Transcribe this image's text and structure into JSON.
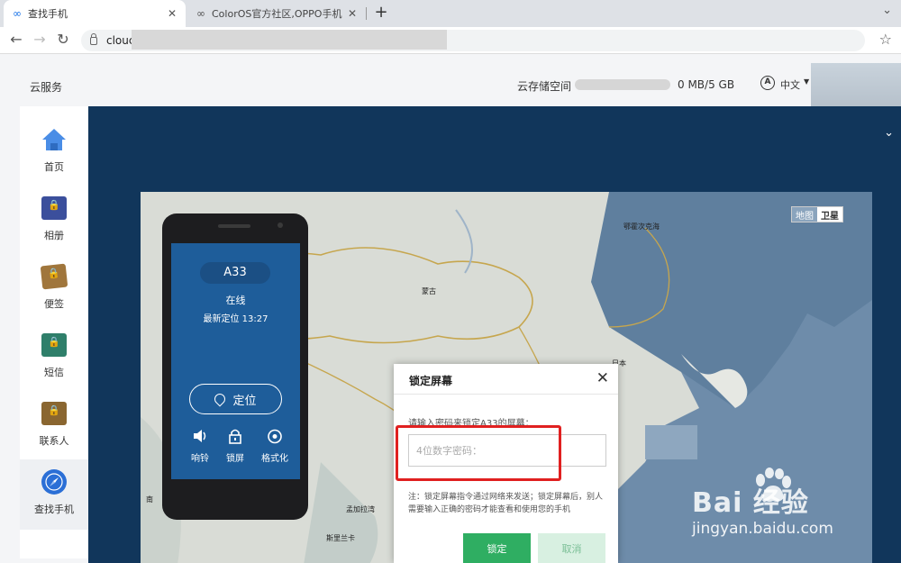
{
  "browser": {
    "tabs": [
      {
        "title": "查找手机",
        "active": true
      },
      {
        "title": "ColorOS官方社区,OPPO手机系",
        "active": false
      }
    ],
    "new_tab": "+",
    "url": "clouc"
  },
  "header": {
    "brand": "云服务",
    "storage_label": "云存储空间",
    "storage_used_fraction": 0.0,
    "storage_text": "0 MB/5 GB",
    "language": "中文"
  },
  "sidebar": {
    "items": [
      {
        "label": "首页",
        "icon": "home-icon",
        "color": "#4a8de6"
      },
      {
        "label": "相册",
        "icon": "album-lock-icon",
        "color": "#3b4f9c"
      },
      {
        "label": "便签",
        "icon": "notes-lock-icon",
        "color": "#a0763c"
      },
      {
        "label": "短信",
        "icon": "sms-lock-icon",
        "color": "#2f7f6a"
      },
      {
        "label": "联系人",
        "icon": "contacts-lock-icon",
        "color": "#8a6630"
      },
      {
        "label": "查找手机",
        "icon": "find-phone-icon",
        "color": "#2b6fd6",
        "active": true
      }
    ]
  },
  "map": {
    "toggle": {
      "map": "地图",
      "satellite": "卫星",
      "selected": "satellite"
    },
    "labels": [
      "鄂霍次克海",
      "蒙古",
      "日本",
      "孟加拉湾",
      "斯里兰卡"
    ],
    "partial_labels": [
      "南"
    ]
  },
  "phone": {
    "model": "A33",
    "status": "在线",
    "last_located": "最新定位 13:27",
    "locate_label": "定位",
    "actions": [
      {
        "label": "响铃",
        "icon": "speaker-icon"
      },
      {
        "label": "锁屏",
        "icon": "lock-icon"
      },
      {
        "label": "格式化",
        "icon": "format-icon"
      }
    ]
  },
  "modal": {
    "title": "锁定屏幕",
    "prompt": "请输入密码来锁定A33的屏幕：",
    "input_placeholder": "4位数字密码：",
    "note": "注：锁定屏幕指令通过网络来发送；锁定屏幕后，别人需要输入正确的密码才能查看和使用您的手机",
    "confirm": "锁定",
    "cancel": "取消"
  },
  "watermark": {
    "text": "Bai 经验",
    "url": "jingyan.baidu.com"
  },
  "colors": {
    "main_bg": "#11365b",
    "phone_screen": "#1e5d9a",
    "confirm_green": "#2fae62",
    "highlight_red": "#e02020"
  }
}
